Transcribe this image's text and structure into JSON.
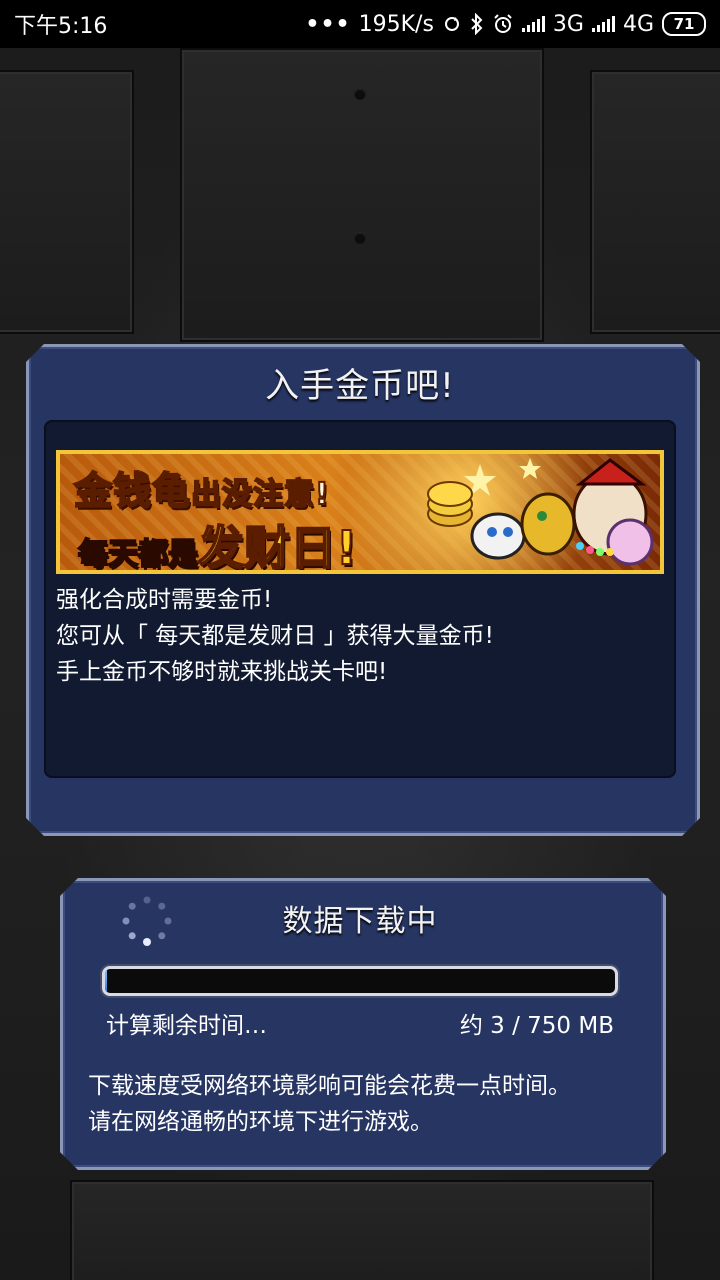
{
  "status_bar": {
    "time": "下午5:16",
    "dots": "•••",
    "net_speed": "195K/s",
    "network_3g": "3G",
    "network_4g": "4G",
    "battery": "71"
  },
  "coin_dialog": {
    "title": "入手金币吧!",
    "banner": {
      "line1_big": "金钱龟",
      "line1_small": "出没注意!",
      "line2_prefix": "每天都是",
      "line2_big": "发财日!"
    },
    "description": [
      "强化合成时需要金币!",
      "您可从「 每天都是发财日 」获得大量金币!",
      "手上金币不够时就来挑战关卡吧!"
    ]
  },
  "download_dialog": {
    "title": "数据下载中",
    "progress": 0.004,
    "remaining_label": "计算剩余时间…",
    "size_label": "约 3 / 750 MB",
    "notice": [
      "下载速度受网络环境影响可能会花费一点时间。",
      "请在网络通畅的环境下进行游戏。"
    ]
  }
}
